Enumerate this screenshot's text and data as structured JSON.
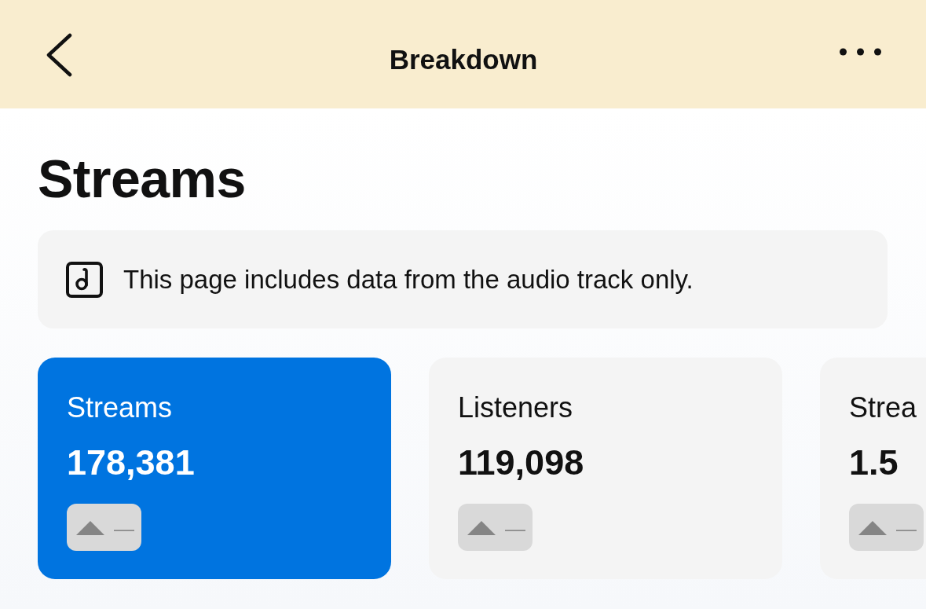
{
  "header": {
    "title": "Breakdown"
  },
  "page_title": "Streams",
  "notice": {
    "text": "This page includes data from the audio track only."
  },
  "metrics": [
    {
      "label": "Streams",
      "value": "178,381",
      "change": "—",
      "selected": true
    },
    {
      "label": "Listeners",
      "value": "119,098",
      "change": "—",
      "selected": false
    },
    {
      "label": "Strea",
      "value": "1.5",
      "change": "—",
      "selected": false
    }
  ]
}
